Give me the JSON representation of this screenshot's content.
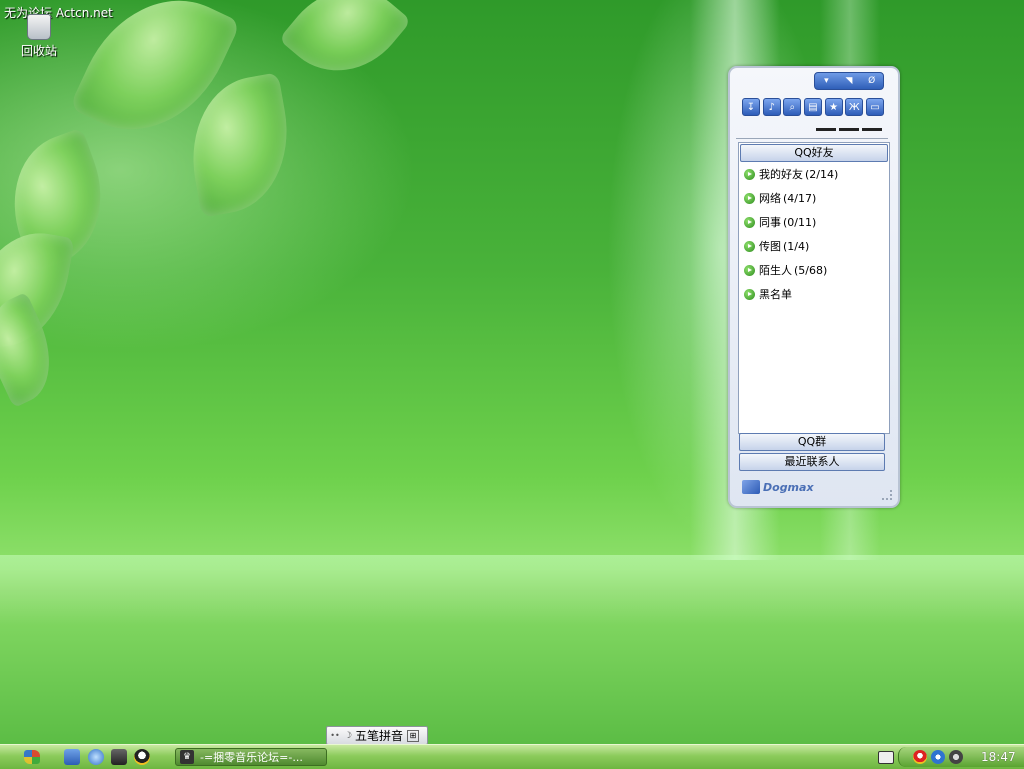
{
  "desktop": {
    "watermark": "无为论坛 Actcn.net",
    "recycle_bin_label": "回收站"
  },
  "qq_panel": {
    "titlebar_icons": [
      "dropdown-icon",
      "minimize-icon",
      "close-icon"
    ],
    "titlebar_glyphs": [
      "▾",
      "◥",
      "Ø"
    ],
    "toolbar_icons": [
      "file-transfer-icon",
      "sound-icon",
      "search-icon",
      "clipboard-icon",
      "star-icon",
      "butterfly-icon",
      "folder-icon"
    ],
    "toolbar_glyphs": [
      "↧",
      "♪",
      "⌕",
      "▤",
      "★",
      "Ж",
      "▭"
    ],
    "friends_header": "QQ好友",
    "groups": [
      {
        "label": "我的好友",
        "count": "(2/14)"
      },
      {
        "label": "网络",
        "count": "(4/17)"
      },
      {
        "label": "同事",
        "count": "(0/11)"
      },
      {
        "label": "传图",
        "count": "(1/4)"
      },
      {
        "label": "陌生人",
        "count": "(5/68)"
      },
      {
        "label": "黑名单",
        "count": ""
      }
    ],
    "qq_group_button": "QQ群",
    "recent_contacts_button": "最近联系人",
    "brand": "Dogmax"
  },
  "ime_bar": {
    "dots": "••",
    "moon": "☽",
    "label": "五笔拼音",
    "menu": "⊞"
  },
  "taskbar": {
    "quick_launch": [
      "show-desktop-icon",
      "browser-icon",
      "media-player-icon",
      "qq-penguin-icon"
    ],
    "task_button_label": "-=捆零音乐论坛=-...",
    "task_icon_glyph": "♛",
    "clock": "18:47",
    "tray_icons": [
      "qq-tray-icon",
      "eye-tray-icon",
      "volume-tray-icon"
    ]
  },
  "colors": {
    "desktop_green": "#49b23a",
    "qq_accent": "#2f5fb8",
    "taskbar_green": "#6db640"
  }
}
